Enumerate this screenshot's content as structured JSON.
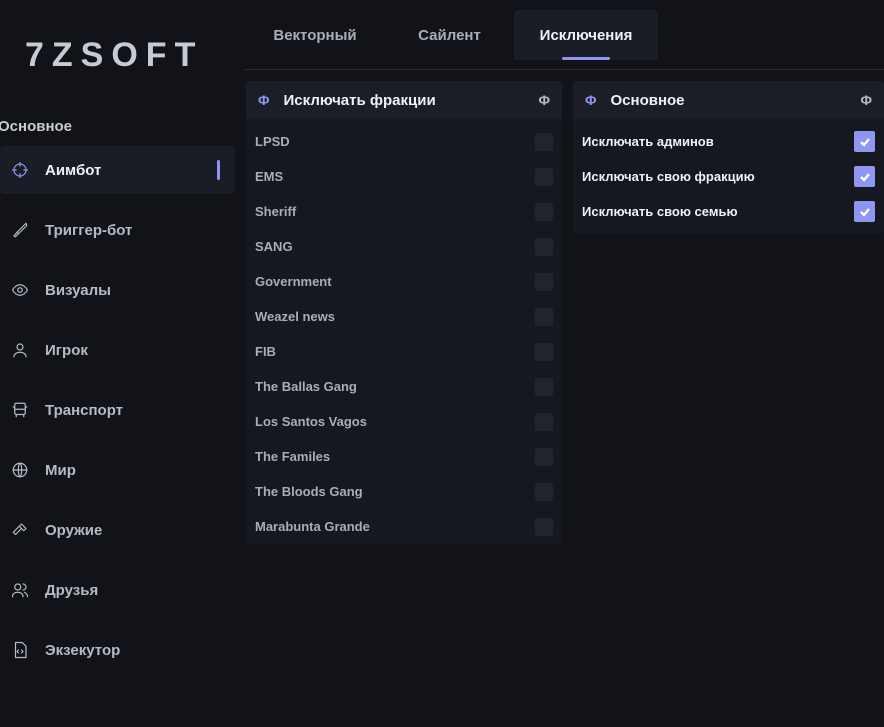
{
  "logo": "7ZSOFT",
  "sidebar": {
    "section_title": "Основное",
    "items": [
      {
        "label": "Аимбот",
        "icon": "crosshair-icon",
        "active": true
      },
      {
        "label": "Триггер-бот",
        "icon": "knife-icon",
        "active": false
      },
      {
        "label": "Визуалы",
        "icon": "eye-icon",
        "active": false
      },
      {
        "label": "Игрок",
        "icon": "user-icon",
        "active": false
      },
      {
        "label": "Транспорт",
        "icon": "bus-icon",
        "active": false
      },
      {
        "label": "Мир",
        "icon": "globe-icon",
        "active": false
      },
      {
        "label": "Оружие",
        "icon": "hammer-icon",
        "active": false
      },
      {
        "label": "Друзья",
        "icon": "users-icon",
        "active": false
      },
      {
        "label": "Экзекутор",
        "icon": "code-file-icon",
        "active": false
      }
    ]
  },
  "tabs": [
    {
      "label": "Векторный",
      "active": false
    },
    {
      "label": "Сайлент",
      "active": false
    },
    {
      "label": "Исключения",
      "active": true
    }
  ],
  "factions_panel": {
    "title": "Исключать фракции",
    "icon_glyph": "Φ",
    "items": [
      {
        "label": "LPSD",
        "checked": false
      },
      {
        "label": "EMS",
        "checked": false
      },
      {
        "label": "Sheriff",
        "checked": false
      },
      {
        "label": "SANG",
        "checked": false
      },
      {
        "label": "Government",
        "checked": false
      },
      {
        "label": "Weazel news",
        "checked": false
      },
      {
        "label": "FIB",
        "checked": false
      },
      {
        "label": "The Ballas Gang",
        "checked": false
      },
      {
        "label": "Los Santos Vagos",
        "checked": false
      },
      {
        "label": "The Familes",
        "checked": false
      },
      {
        "label": "The Bloods Gang",
        "checked": false
      },
      {
        "label": "Marabunta Grande",
        "checked": false
      }
    ]
  },
  "main_panel": {
    "title": "Основное",
    "icon_glyph": "Φ",
    "items": [
      {
        "label": "Исключать админов",
        "checked": true
      },
      {
        "label": "Исключать свою фракцию",
        "checked": true
      },
      {
        "label": "Исключать свою семью",
        "checked": true
      }
    ]
  },
  "colors": {
    "accent": "#8e96f2",
    "background": "#111318",
    "panel": "#16181f"
  }
}
